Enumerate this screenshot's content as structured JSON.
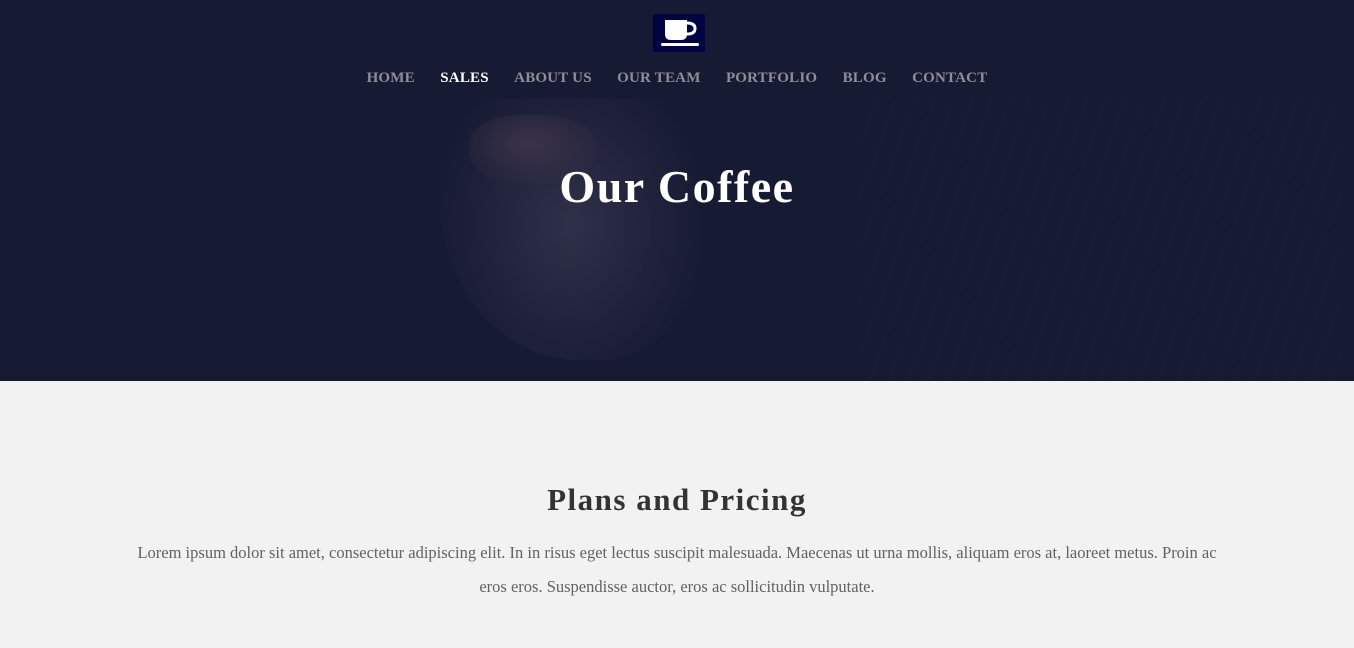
{
  "header": {
    "logo_icon": "coffee-cup-icon",
    "nav": [
      {
        "label": "HOME"
      },
      {
        "label": "SALES",
        "active": true
      },
      {
        "label": "ABOUT US"
      },
      {
        "label": "OUR TEAM"
      },
      {
        "label": "PORTFOLIO"
      },
      {
        "label": "BLOG"
      },
      {
        "label": "CONTACT"
      }
    ]
  },
  "hero": {
    "title": "Our Coffee"
  },
  "pricing": {
    "title": "Plans and Pricing",
    "description": "Lorem ipsum dolor sit amet, consectetur adipiscing elit. In in risus eget lectus suscipit malesuada. Maecenas ut urna mollis, aliquam eros at, laoreet metus. Proin ac eros eros. Suspendisse auctor, eros ac sollicitudin vulputate."
  },
  "colors": {
    "hero_bg": "#171a33",
    "logo_bg": "#020442",
    "nav_text": "#8e8e98",
    "nav_active": "#ffffff",
    "section_bg": "#f2f2f2",
    "heading": "#333333",
    "body_text": "#626262"
  }
}
